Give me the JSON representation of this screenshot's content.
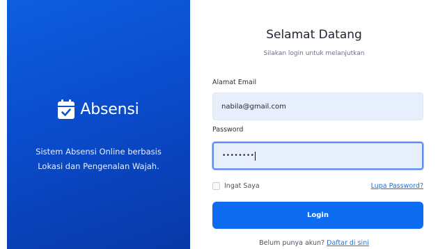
{
  "brand": {
    "name": "Absensi",
    "tagline_line1": "Sistem Absensi Online berbasis",
    "tagline_line2": "Lokasi dan Pengenalan Wajah.",
    "icon": "calendar-check-icon",
    "gradient_start": "#0d5fe0",
    "gradient_end": "#0838a8"
  },
  "form": {
    "title": "Selamat Datang",
    "subtitle": "Silakan login untuk melanjutkan",
    "email_label": "Alamat Email",
    "email_value": "nabila@gmail.com",
    "password_label": "Password",
    "password_value": "••••••••",
    "remember_label": "Ingat Saya",
    "remember_checked": false,
    "forgot_label": "Lupa Password?",
    "login_label": "Login",
    "register_prompt": "Belum punya akun?",
    "register_link": "Daftar di sini",
    "accent_color": "#0d6cf0"
  }
}
